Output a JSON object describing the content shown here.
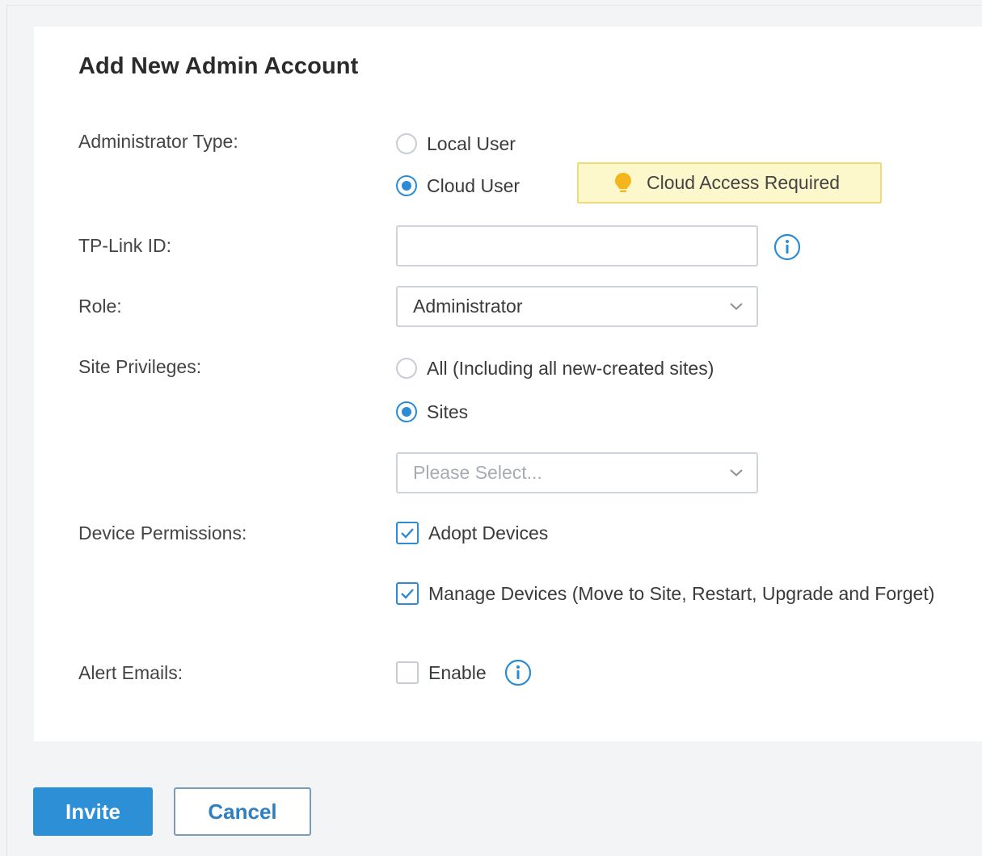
{
  "form": {
    "title": "Add New Admin Account",
    "admin_type": {
      "label": "Administrator Type:",
      "options": [
        {
          "label": "Local User",
          "selected": false
        },
        {
          "label": "Cloud User",
          "selected": true
        }
      ],
      "cloud_badge": "Cloud Access Required"
    },
    "tplink_id": {
      "label": "TP-Link ID:",
      "value": ""
    },
    "role": {
      "label": "Role:",
      "value": "Administrator"
    },
    "site_privileges": {
      "label": "Site Privileges:",
      "options": [
        {
          "label": "All (Including all new-created sites)",
          "selected": false
        },
        {
          "label": "Sites",
          "selected": true
        }
      ],
      "sites_placeholder": "Please Select..."
    },
    "device_permissions": {
      "label": "Device Permissions:",
      "options": [
        {
          "label": "Adopt Devices",
          "checked": true
        },
        {
          "label": "Manage Devices (Move to Site, Restart, Upgrade and Forget)",
          "checked": true
        }
      ]
    },
    "alert_emails": {
      "label": "Alert Emails:",
      "option": {
        "label": "Enable",
        "checked": false
      }
    }
  },
  "actions": {
    "invite_label": "Invite",
    "cancel_label": "Cancel"
  },
  "icons": {
    "info": "info-icon",
    "bulb": "lightbulb-icon",
    "chevron": "chevron-down-icon",
    "check": "checkmark-icon"
  },
  "colors": {
    "accent": "#2b8bd4",
    "badge_bg": "#fdf7cc",
    "badge_border": "#f0d97a",
    "bulb": "#f5b51c"
  }
}
